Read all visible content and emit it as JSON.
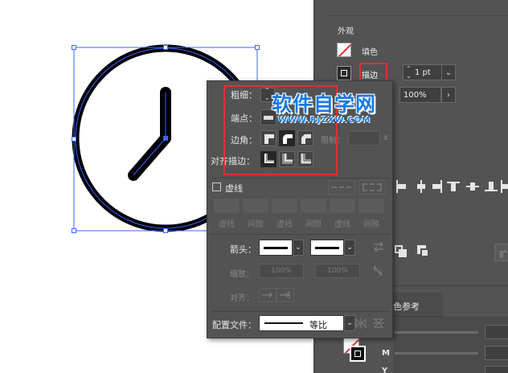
{
  "appearance_panel": {
    "title": "外观",
    "fill_label": "填色",
    "stroke_label": "描边",
    "stroke_weight": "1 pt",
    "opacity": "100%",
    "color_ref_tab": "色参考",
    "color_slider_labels": [
      "M",
      "Y"
    ],
    "expand_label": "扩"
  },
  "stroke_panel": {
    "weight_label": "粗细：",
    "cap_label": "端点：",
    "corner_label": "边角：",
    "limit_label": "限制：",
    "limit_unit": "x",
    "align_label": "对齐描边：",
    "dashed_checkbox_label": "虚线",
    "dash_labels": [
      "虚线",
      "间隙",
      "虚线",
      "间隙",
      "虚线",
      "间隙"
    ],
    "arrow_label": "箭头：",
    "scale_label": "缩放：",
    "scale_values": [
      "100%",
      "100%"
    ],
    "align_arrow_label": "对齐：",
    "profile_label": "配置文件：",
    "profile_value": "等比"
  },
  "watermark": {
    "title": "软件自学网",
    "url": "WWW.RJZXW.COM"
  },
  "colors": {
    "panel_bg": "#535353",
    "highlight_red": "#e0312f",
    "selection_blue": "#3e64ff",
    "watermark_blue": "#1779e6"
  }
}
